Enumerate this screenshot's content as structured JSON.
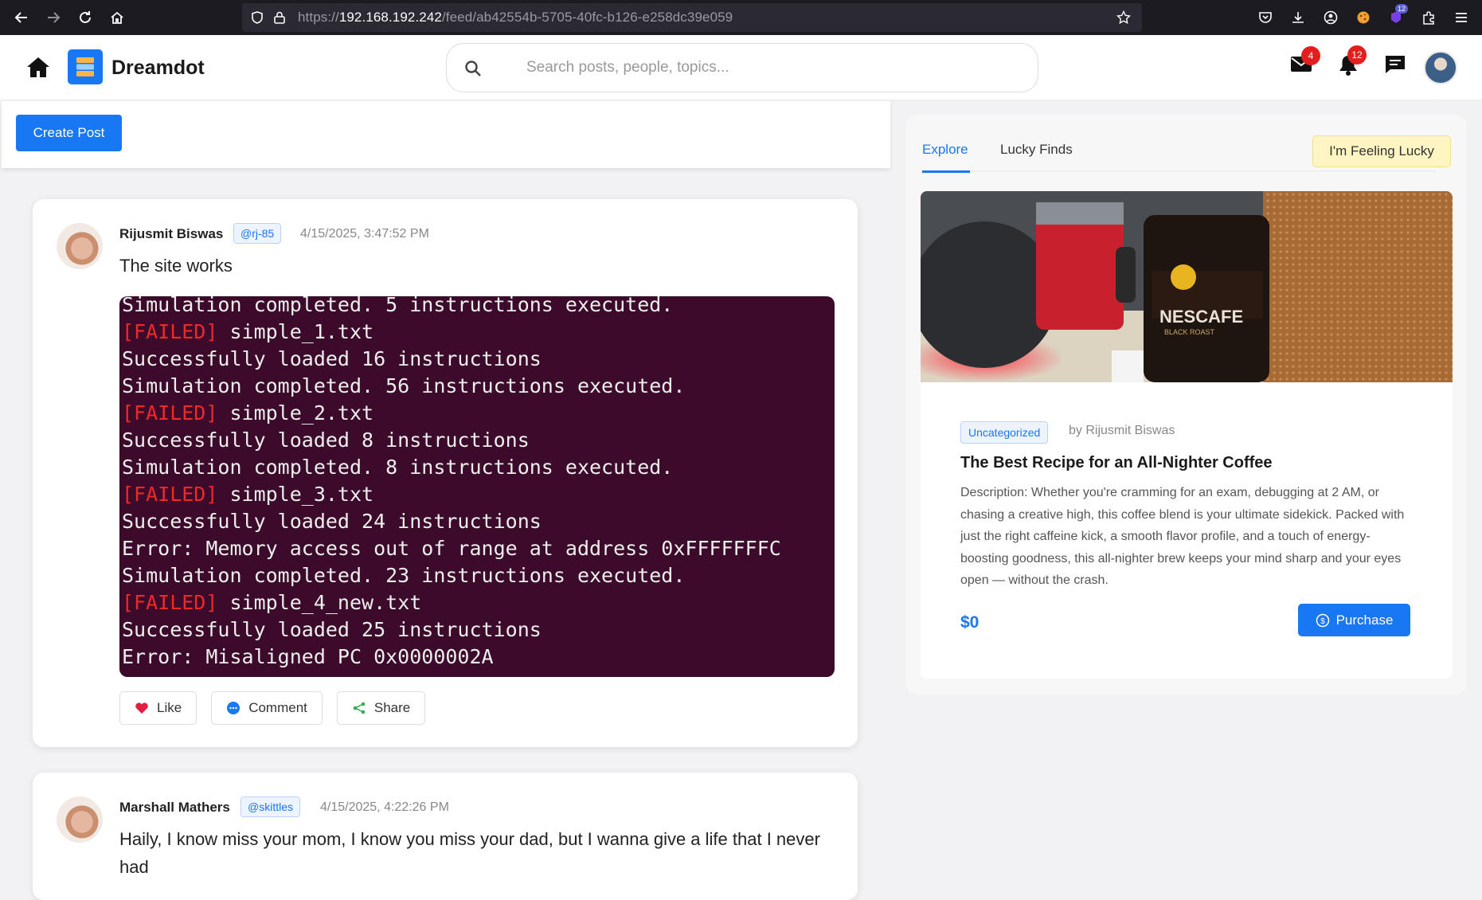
{
  "browser": {
    "url_prefix": "https://",
    "url_host": "192.168.192.242",
    "url_path": "/feed/ab42554b-5705-40fc-b126-e258dc39e059",
    "extension_badge": "12"
  },
  "header": {
    "brand": "Dreamdot",
    "search_placeholder": "Search posts, people, topics...",
    "mail_count": "4",
    "notification_count": "12"
  },
  "toolbar": {
    "create_post_label": "Create Post"
  },
  "posts": [
    {
      "author": "Rijusmit Biswas",
      "handle": "@rj-85",
      "time": "4/15/2025, 3:47:52 PM",
      "text": "The site works",
      "terminal_lines": [
        {
          "fail": "",
          "text": "Simulation completed. 5 instructions executed."
        },
        {
          "fail": "[FAILED]",
          "text": " simple_1.txt"
        },
        {
          "fail": "",
          "text": "Successfully loaded 16 instructions"
        },
        {
          "fail": "",
          "text": "Simulation completed. 56 instructions executed."
        },
        {
          "fail": "[FAILED]",
          "text": " simple_2.txt"
        },
        {
          "fail": "",
          "text": "Successfully loaded 8 instructions"
        },
        {
          "fail": "",
          "text": "Simulation completed. 8 instructions executed."
        },
        {
          "fail": "[FAILED]",
          "text": " simple_3.txt"
        },
        {
          "fail": "",
          "text": "Successfully loaded 24 instructions"
        },
        {
          "fail": "",
          "text": "Error: Memory access out of range at address 0xFFFFFFFC"
        },
        {
          "fail": "",
          "text": "Simulation completed. 23 instructions executed."
        },
        {
          "fail": "[FAILED]",
          "text": " simple_4_new.txt"
        },
        {
          "fail": "",
          "text": "Successfully loaded 25 instructions"
        },
        {
          "fail": "",
          "text": "Error: Misaligned PC 0x0000002A"
        }
      ],
      "actions": {
        "like": "Like",
        "comment": "Comment",
        "share": "Share"
      }
    },
    {
      "author": "Marshall Mathers",
      "handle": "@skittles",
      "time": "4/15/2025, 4:22:26 PM",
      "text": "Haily, I know miss your mom, I know you miss your dad, but I wanna give a life that I never had"
    }
  ],
  "sidebar": {
    "tabs": [
      "Explore",
      "Lucky Finds"
    ],
    "lucky_button": "I'm Feeling Lucky",
    "card": {
      "category": "Uncategorized",
      "by": "by Rijusmit Biswas",
      "title": "The Best Recipe for an All-Nighter Coffee",
      "description": "Description: Whether you're cramming for an exam, debugging at 2 AM, or chasing a creative high, this coffee blend is your ultimate sidekick. Packed with just the right caffeine kick, a smooth flavor profile, and a touch of energy-boosting goodness, this all-nighter brew keeps your mind sharp and your eyes open — without the crash.",
      "price": "$0",
      "purchase_label": "Purchase",
      "photo_jar_label": "NESCAFE",
      "photo_jar_sublabel": "BLACK ROAST"
    }
  },
  "colors": {
    "accent": "#1877f2",
    "terminal_bg": "#3c0a2a",
    "terminal_fail": "#ef2929",
    "badge": "#e41e1e"
  }
}
